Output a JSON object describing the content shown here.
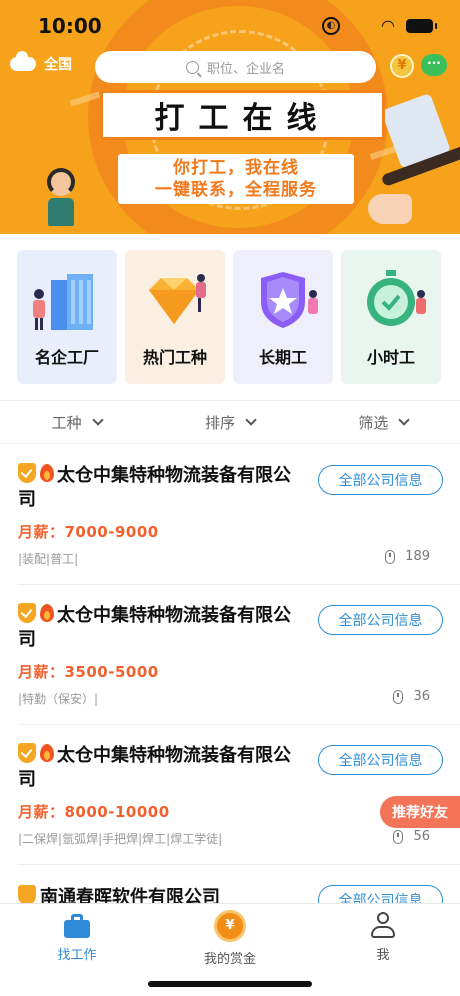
{
  "status_bar": {
    "time": "10:00"
  },
  "header": {
    "city": "全国",
    "search_placeholder": "职位、企业名",
    "coin_glyph": "¥",
    "chat_glyph": "···"
  },
  "banner": {
    "title": "打工在线",
    "subtitle_line1": "你打工，我在线",
    "subtitle_line2": "一键联系，全程服务"
  },
  "categories": [
    {
      "label": "名企工厂",
      "icon": "factory-building-icon"
    },
    {
      "label": "热门工种",
      "icon": "diamond-icon"
    },
    {
      "label": "长期工",
      "icon": "shield-star-icon"
    },
    {
      "label": "小时工",
      "icon": "stopwatch-icon"
    }
  ],
  "filters": [
    {
      "label": "工种"
    },
    {
      "label": "排序"
    },
    {
      "label": "筛选"
    }
  ],
  "jobs": [
    {
      "company": "太仓中集特种物流装备有限公司",
      "button": "全部公司信息",
      "salary": "月薪：7000-9000",
      "tags": "|装配|普工|",
      "views": "189"
    },
    {
      "company": "太仓中集特种物流装备有限公司",
      "button": "全部公司信息",
      "salary": "月薪：3500-5000",
      "tags": "|特勤（保安）|",
      "views": "36"
    },
    {
      "company": "太仓中集特种物流装备有限公司",
      "button": "全部公司信息",
      "salary": "月薪：8000-10000",
      "tags": "|二保焊|氩弧焊|手把焊|焊工|焊工学徒|",
      "views": "56"
    },
    {
      "company": "南通春晖软件有限公司",
      "button": "全部公司信息"
    }
  ],
  "floating_button": "推荐好友",
  "tabbar": [
    {
      "label": "找工作",
      "active": true
    },
    {
      "label": "我的赏金",
      "glyph": "¥"
    },
    {
      "label": "我"
    }
  ],
  "colors": {
    "accent_blue": "#2f8ad8",
    "salary_orange": "#f2612d",
    "banner_orange": "#f7a21b"
  }
}
